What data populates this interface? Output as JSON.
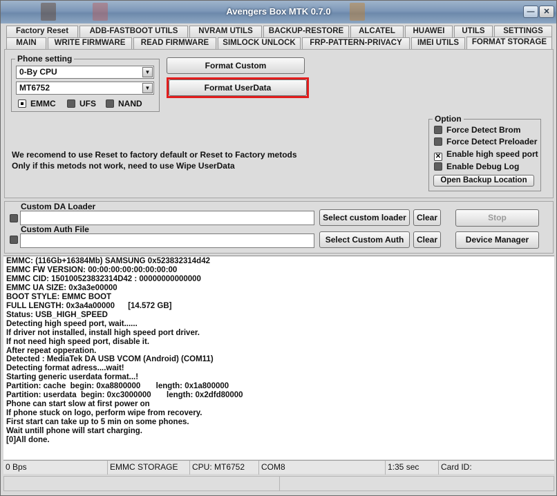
{
  "window": {
    "title": "Avengers Box MTK 0.7.0"
  },
  "tabs_row1": [
    "Factory Reset",
    "ADB-FASTBOOT UTILS",
    "NVRAM UTILS",
    "BACKUP-RESTORE",
    "ALCATEL",
    "HUAWEI",
    "UTILS",
    "SETTINGS"
  ],
  "tabs_row2": [
    "MAIN",
    "WRITE FIRMWARE",
    "READ FIRMWARE",
    "SIMLOCK UNLOCK",
    "FRP-PATTERN-PRIVACY",
    "IMEI UTILS",
    "FORMAT STORAGE"
  ],
  "active_tab": "FORMAT STORAGE",
  "phone_setting": {
    "legend": "Phone setting",
    "mode_select": "0-By CPU",
    "cpu_select": "MT6752",
    "storage": [
      {
        "label": "EMMC",
        "selected": true
      },
      {
        "label": "UFS",
        "selected": false
      },
      {
        "label": "NAND",
        "selected": false
      }
    ]
  },
  "actions": {
    "format_custom": "Format Custom",
    "format_userdata": "Format UserData"
  },
  "notice": {
    "line1": "We recomend to use Reset to factory default or Reset to Factory metods",
    "line2": "Only if this metods not work, need to use Wipe UserData"
  },
  "options": {
    "legend": "Option",
    "items": [
      {
        "label": "Force Detect Brom",
        "checked": false
      },
      {
        "label": "Force Detect Preloader",
        "checked": false
      },
      {
        "label": "Enable high speed port",
        "checked": true
      },
      {
        "label": "Enable Debug Log",
        "checked": false
      }
    ],
    "open_backup": "Open Backup Location"
  },
  "loader": {
    "custom_da_label": "Custom DA Loader",
    "custom_auth_label": "Custom Auth File",
    "select_loader": "Select custom loader",
    "select_auth": "Select Custom Auth",
    "clear": "Clear",
    "stop": "Stop",
    "device_manager": "Device Manager"
  },
  "log_lines": [
    "EMMC: (116Gb+16384Mb) SAMSUNG 0x523832314d42",
    "EMMC FW VERSION: 00:00:00:00:00:00:00:00",
    "EMMC CID: 150100523832314D42 : 00000000000000",
    "EMMC UA SIZE: 0x3a3e00000",
    "BOOT STYLE: EMMC BOOT",
    "FULL LENGTH: 0x3a4a00000      [14.572 GB]",
    "Status: USB_HIGH_SPEED",
    "Detecting high speed port, wait......",
    "If driver not installed, install high speed port driver.",
    "If not need high speed port, disable it.",
    "After repeat opperation.",
    "Detected : MediaTek DA USB VCOM (Android) (COM11)",
    "Detecting format adress....wait!",
    "Starting generic userdata format...!",
    "Partition: cache  begin: 0xa8800000       length: 0x1a800000",
    "Partition: userdata  begin: 0xc3000000       length: 0x2dfd80000",
    "Phone can start slow at first power on",
    "If phone stuck on logo, perform wipe from recovery.",
    "First start can take up to 5 min on some phones.",
    "Wait untill phone will start charging.",
    "[0]All done."
  ],
  "status": {
    "speed": "0 Bps",
    "mode": "EMMC STORAGE",
    "cpu": "CPU: MT6752",
    "port": "COM8",
    "time": "1:35 sec",
    "card": "Card ID:"
  },
  "colors": {
    "highlight": "#e21d1d",
    "titlebar": "#7d98b8"
  }
}
